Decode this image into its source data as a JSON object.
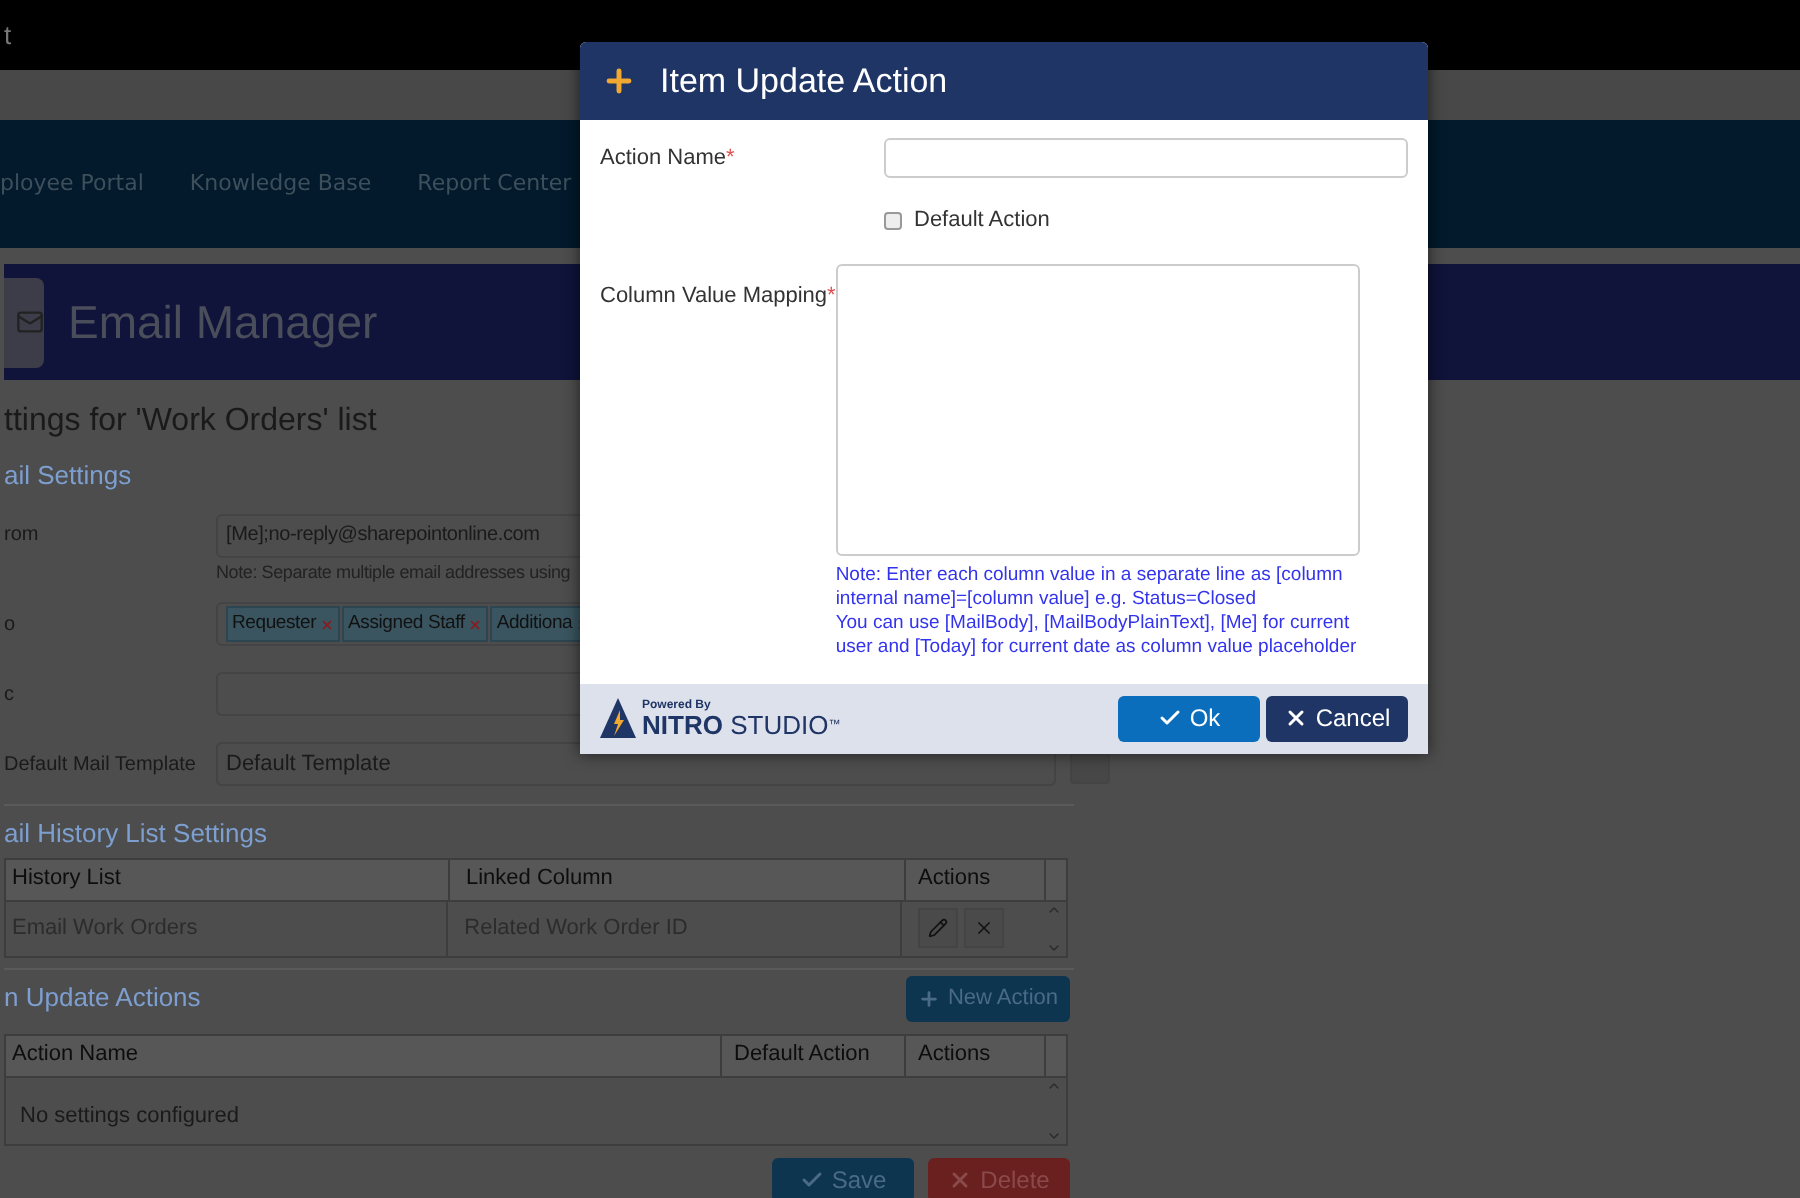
{
  "top_bar": {
    "title": "t"
  },
  "nav": {
    "items": [
      "ployee Portal",
      "Knowledge Base",
      "Report Center"
    ]
  },
  "banner": {
    "title": "Email Manager"
  },
  "page_title": "ttings for 'Work Orders' list",
  "mail_settings": {
    "heading": "ail Settings",
    "fields": [
      {
        "label": "rom",
        "kind": "text",
        "value": "[Me];no-reply@sharepointonline.com",
        "note": "Note: Separate multiple email addresses using"
      },
      {
        "label": "o",
        "kind": "tags",
        "tags": [
          "Requester",
          "Assigned Staff",
          "Additiona"
        ]
      },
      {
        "label": "c",
        "kind": "text"
      },
      {
        "label": "Default Mail Template",
        "kind": "select",
        "value": "Default Template"
      }
    ]
  },
  "history": {
    "heading": "ail History List Settings",
    "columns": [
      "History List",
      "Linked Column",
      "Actions"
    ],
    "rows": [
      {
        "cells": [
          "Email Work Orders",
          "Related Work Order ID"
        ]
      }
    ]
  },
  "update_actions": {
    "heading": "n Update Actions",
    "new_action_button": "New Action",
    "columns": [
      "Action Name",
      "Default Action",
      "Actions"
    ],
    "empty_text": "No settings configured"
  },
  "page_buttons": [
    {
      "label": "Save",
      "kind": "primary"
    },
    {
      "label": "Delete",
      "kind": "danger"
    }
  ],
  "dialog": {
    "title": "Item Update Action",
    "fields": [
      {
        "kind": "text",
        "label": "Action Name",
        "required_mark": "*"
      },
      {
        "kind": "checkbox",
        "label": "Default Action",
        "checked": false
      },
      {
        "kind": "textarea",
        "label": "Column Value Mapping",
        "required_mark": "*",
        "notes": [
          "Note: Enter each column value in a separate line as [column internal name]=[column value] e.g. Status=Closed",
          "You can use [MailBody], [MailBodyPlainText], [Me] for current user and [Today] for current date as column value placeholder"
        ]
      }
    ],
    "brand": {
      "powered_by": "Powered By",
      "name_bold": "NITRO",
      "name": "STUDIO",
      "trademark": "™"
    },
    "buttons": [
      {
        "label": "Ok",
        "kind": "primary"
      },
      {
        "label": "Cancel",
        "kind": "secondary"
      }
    ]
  }
}
